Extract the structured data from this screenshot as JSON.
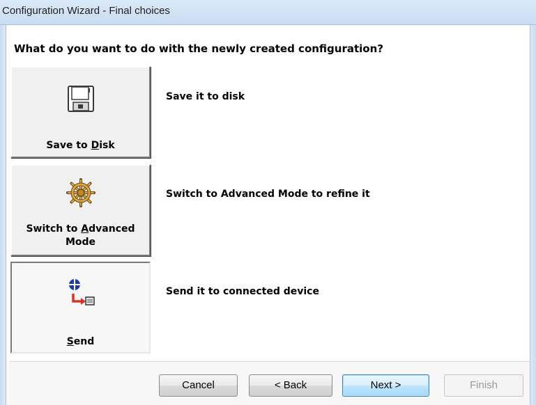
{
  "window": {
    "title": "Configuration Wizard - Final choices"
  },
  "question": "What do you want to do with the newly created configuration?",
  "options": [
    {
      "label_pre": "Save to ",
      "label_key": "D",
      "label_post": "isk",
      "icon": "floppy-disk-icon",
      "description": "Save it to disk"
    },
    {
      "label_pre": "Switch to ",
      "label_key": "A",
      "label_post": "dvanced",
      "label_line2": "Mode",
      "icon": "ship-wheel-icon",
      "description": "Switch to Advanced Mode to refine it"
    },
    {
      "label_pre": "",
      "label_key": "S",
      "label_post": "end",
      "icon": "send-to-device-icon",
      "description": "Send it to connected device"
    }
  ],
  "buttons": {
    "cancel": "Cancel",
    "back": "< Back",
    "next": "Next >",
    "finish": "Finish"
  },
  "colors": {
    "title_bar": "#c9dcf1",
    "default_button": "#bee6fd",
    "send_arrow": "#e0302a",
    "send_dot": "#1b3f9c"
  }
}
